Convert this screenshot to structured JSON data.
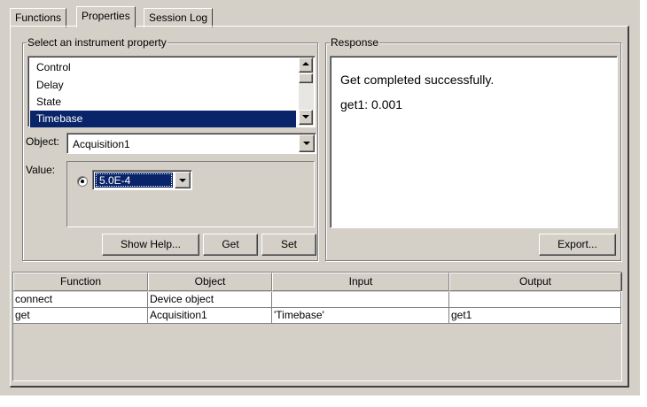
{
  "tabs": [
    {
      "label": "Functions"
    },
    {
      "label": "Properties"
    },
    {
      "label": "Session Log"
    }
  ],
  "active_tab": "Properties",
  "property_group": {
    "title": "Select an instrument property",
    "list_items": [
      "Control",
      "Delay",
      "State",
      "Timebase"
    ],
    "selected_item": "Timebase",
    "object_label": "Object:",
    "object_value": "Acquisition1",
    "value_label": "Value:",
    "value_selected": "5.0E-4",
    "buttons": {
      "show_help": "Show Help...",
      "get": "Get",
      "set": "Set"
    }
  },
  "response_group": {
    "title": "Response",
    "line1": "Get completed successfully.",
    "line2": "get1: 0.001",
    "export_button": "Export..."
  },
  "log_table": {
    "headers": [
      "Function",
      "Object",
      "Input",
      "Output"
    ],
    "rows": [
      [
        "connect",
        "Device object",
        "",
        ""
      ],
      [
        "get",
        "Acquisition1",
        "'Timebase'",
        "get1"
      ]
    ]
  },
  "colors": {
    "face": "#d4d0c8",
    "selection": "#0a246a"
  }
}
